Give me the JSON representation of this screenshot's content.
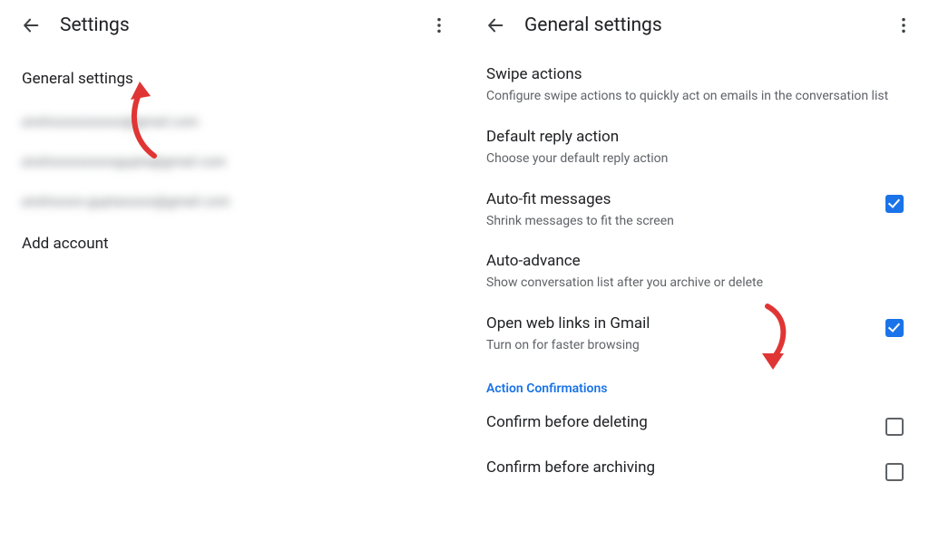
{
  "left": {
    "title": "Settings",
    "items": {
      "general": "General settings",
      "accounts": [
        "anshxxxxxxxxxxx@gmail.com",
        "anshxxxxxxxxxxgupta@gmail.com",
        "anshxxxxx-guptaxxxxx@gmail.com"
      ],
      "addAccount": "Add account"
    }
  },
  "right": {
    "title": "General settings",
    "rows": {
      "swipe": {
        "title": "Swipe actions",
        "subtitle": "Configure swipe actions to quickly act on emails in the conversation list"
      },
      "reply": {
        "title": "Default reply action",
        "subtitle": "Choose your default reply action"
      },
      "autofit": {
        "title": "Auto-fit messages",
        "subtitle": "Shrink messages to fit the screen",
        "checked": true
      },
      "autoadv": {
        "title": "Auto-advance",
        "subtitle": "Show conversation list after you archive or delete"
      },
      "weblinks": {
        "title": "Open web links in Gmail",
        "subtitle": "Turn on for faster browsing",
        "checked": true
      },
      "section_ac": "Action Confirmations",
      "confDel": {
        "title": "Confirm before deleting",
        "checked": false
      },
      "confArc": {
        "title": "Confirm before archiving",
        "checked": false
      }
    }
  }
}
